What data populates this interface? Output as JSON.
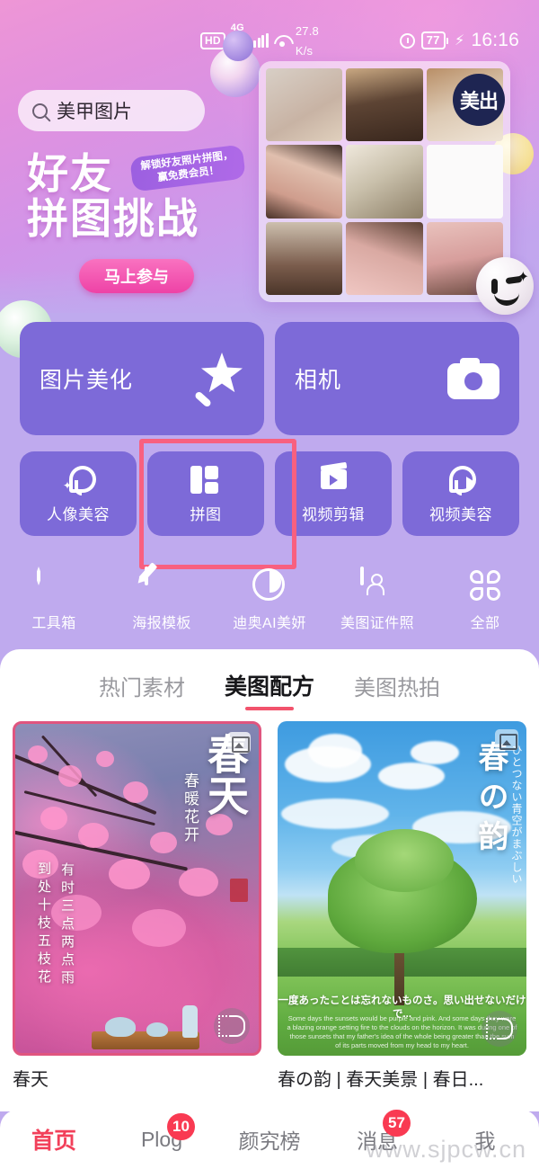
{
  "statusbar": {
    "hd": "HD",
    "network": "4G",
    "speed_value": "27.8",
    "speed_unit": "K/s",
    "battery": "77",
    "time": "16:16"
  },
  "search": {
    "value": "美甲图片",
    "icon": "search-icon"
  },
  "banner": {
    "title_line1": "好友",
    "title_line2": "拼图挑战",
    "badge_line1": "解锁好友照片拼图，",
    "badge_line2": "赢免费会员！",
    "cta": "马上参与",
    "circle_badge": "美出"
  },
  "big_cards": [
    {
      "label": "图片美化",
      "icon": "magic-wand-icon"
    },
    {
      "label": "相机",
      "icon": "camera-icon"
    }
  ],
  "small_cards": [
    {
      "label": "人像美容",
      "icon": "portrait-beauty-icon",
      "highlighted": false
    },
    {
      "label": "拼图",
      "icon": "collage-grid-icon",
      "highlighted": true
    },
    {
      "label": "视频剪辑",
      "icon": "video-clapper-icon",
      "highlighted": false
    },
    {
      "label": "视频美容",
      "icon": "video-beauty-icon",
      "highlighted": false
    }
  ],
  "icon_row": [
    {
      "label": "工具箱",
      "icon": "toolbox-icon"
    },
    {
      "label": "海报模板",
      "icon": "poster-edit-icon"
    },
    {
      "label": "迪奥AI美妍",
      "icon": "dior-circle-icon"
    },
    {
      "label": "美图证件照",
      "icon": "id-photo-icon"
    },
    {
      "label": "全部",
      "icon": "all-grid-icon"
    }
  ],
  "tabs": [
    {
      "label": "热门素材",
      "active": false
    },
    {
      "label": "美图配方",
      "active": true
    },
    {
      "label": "美图热拍",
      "active": false
    }
  ],
  "feed": [
    {
      "caption": "春天",
      "overlay_title": "春天",
      "overlay_subtitle": "春暖花开",
      "overlay_poem_a": "到处十枝五枝花",
      "overlay_poem_b": "有时三点两点雨",
      "chip_icon": "image-icon",
      "watermark_icon": "meitu-watermark-icon"
    },
    {
      "caption": "春の韵 | 春天美景 | 春日...",
      "overlay_title": "春の韵",
      "overlay_subtitle": "ひとつない青空がまぶしい",
      "overlay_jp": "一度あったことは忘れないものさ。思い出せないだけで...",
      "overlay_en": "Some days the sunsets would be purple and pink. And some days they were a blazing orange setting fire to the clouds on the horizon. It was during one of those sunsets that my father's idea of the whole being greater than the sum of its parts moved from my head to my heart.",
      "chip_icon": "image-icon",
      "watermark_icon": "meitu-watermark-icon"
    }
  ],
  "bottom_nav": [
    {
      "label": "首页",
      "badge": "",
      "active": true
    },
    {
      "label": "Plog",
      "badge": "10",
      "active": false
    },
    {
      "label": "颜究榜",
      "badge": "",
      "active": false
    },
    {
      "label": "消息",
      "badge": "57",
      "active": false
    },
    {
      "label": "我",
      "badge": "",
      "active": false
    }
  ],
  "watermark": "www.sjpcw.cn",
  "colors": {
    "accent_pink": "#F2405A",
    "card_purple": "#7D6AD8",
    "background_lavender": "#BFAAEE",
    "highlight_box": "#F8607F",
    "badge_red": "#F93A52"
  }
}
